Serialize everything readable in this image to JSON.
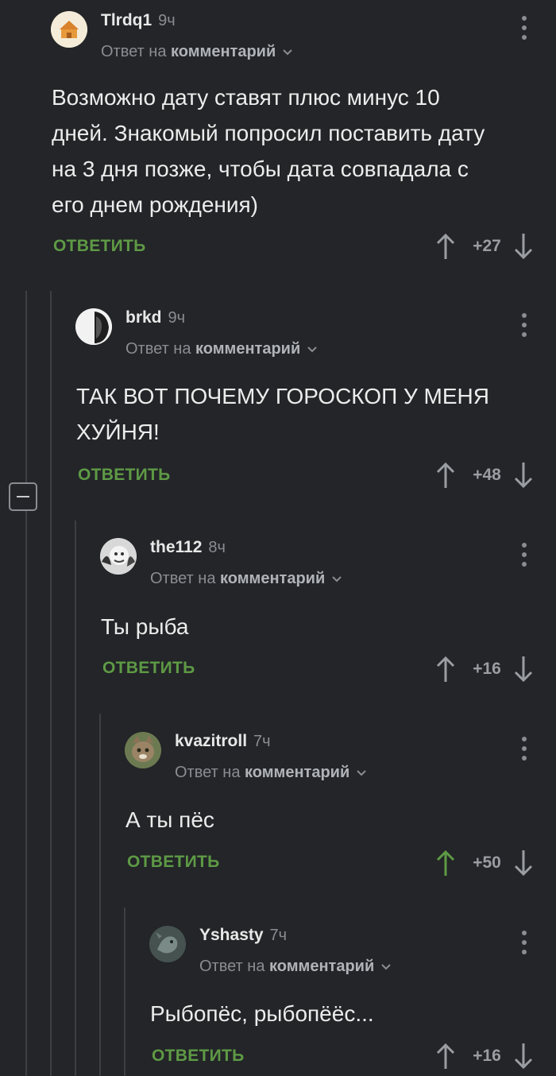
{
  "colors": {
    "background": "#232528",
    "accent_green": "#5e9a45",
    "muted": "#8a8d91",
    "thread_line": "#3c3f43"
  },
  "common": {
    "reply_prefix": "Ответ на",
    "reply_target": "комментарий",
    "reply_button": "ОТВЕТИТЬ"
  },
  "comments": [
    {
      "author": "Tlrdq1",
      "time": "9ч",
      "text": "Возможно дату ставят плюс минус 10 дней. Знакомый попросил поставить дату на 3 дня позже, чтобы дата совпадала с его днем рождения)",
      "score": "+27",
      "upvoted": false
    },
    {
      "author": "brkd",
      "time": "9ч",
      "text": "ТАК ВОТ ПОЧЕМУ ГОРОСКОП У МЕНЯ ХУЙНЯ!",
      "score": "+48",
      "upvoted": false
    },
    {
      "author": "the112",
      "time": "8ч",
      "text": "Ты рыба",
      "score": "+16",
      "upvoted": false
    },
    {
      "author": "kvazitroll",
      "time": "7ч",
      "text": "А ты пёс",
      "score": "+50",
      "upvoted": true
    },
    {
      "author": "Yshasty",
      "time": "7ч",
      "text": "Рыбопёс, рыбопёёс...",
      "score": "+16",
      "upvoted": false
    }
  ]
}
